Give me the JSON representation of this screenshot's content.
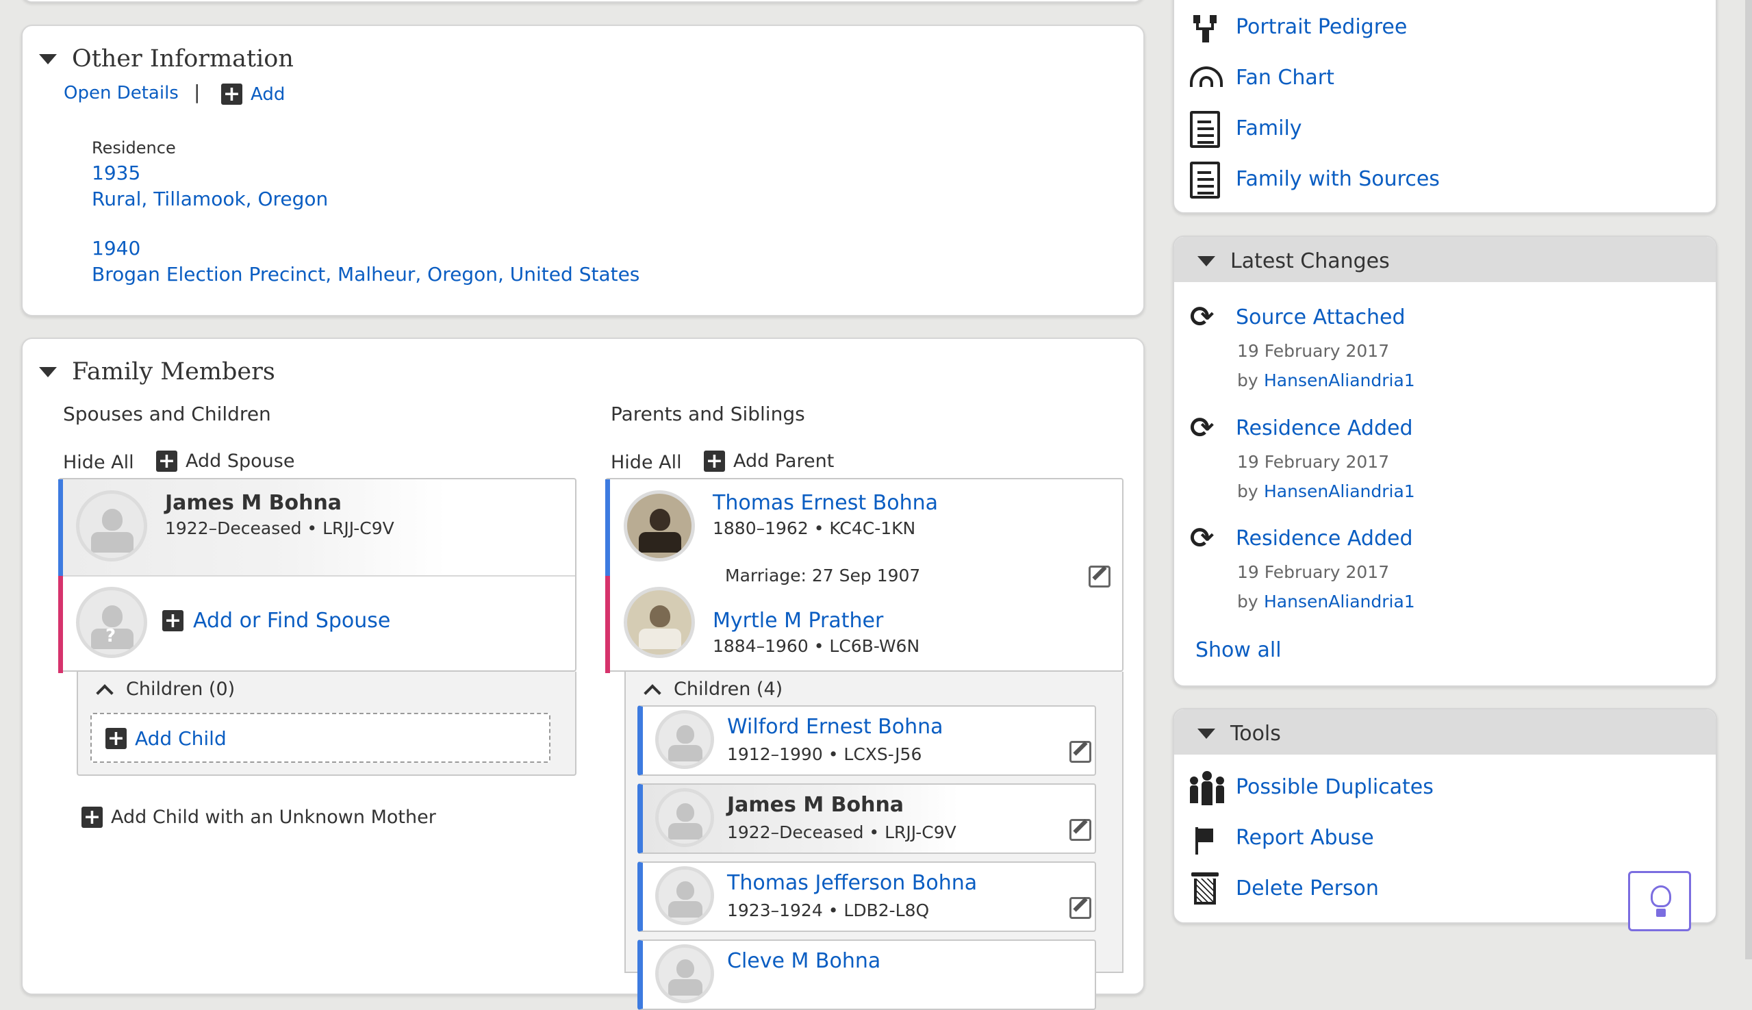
{
  "other_info": {
    "title": "Other Information",
    "open_details": "Open Details",
    "separator": "|",
    "add": "Add",
    "residence_label": "Residence",
    "residences": [
      {
        "year": "1935",
        "place": "Rural, Tillamook, Oregon"
      },
      {
        "year": "1940",
        "place": "Brogan Election Precinct, Malheur, Oregon, United States"
      }
    ]
  },
  "family": {
    "title": "Family Members",
    "spouses_heading": "Spouses and Children",
    "parents_heading": "Parents and Siblings",
    "hide_all": "Hide All",
    "add_spouse": "Add Spouse",
    "add_parent": "Add Parent",
    "self": {
      "name": "James M Bohna",
      "info": "1922–Deceased • LRJJ-C9V"
    },
    "add_or_find_spouse": "Add or Find Spouse",
    "children_none": "Children (0)",
    "add_child": "Add Child",
    "add_child_unknown": "Add Child with an Unknown Mother",
    "father": {
      "name": "Thomas Ernest Bohna",
      "info": "1880–1962 • KC4C-1KN"
    },
    "marriage": "Marriage: 27 Sep 1907",
    "mother": {
      "name": "Myrtle M Prather",
      "info": "1884–1960 • LC6B-W6N"
    },
    "children_count": "Children (4)",
    "children": [
      {
        "name": "Wilford Ernest Bohna",
        "info": "1912–1990 • LCXS-J56"
      },
      {
        "name": "James M Bohna",
        "info": "1922–Deceased • LRJJ-C9V"
      },
      {
        "name": "Thomas Jefferson Bohna",
        "info": "1923–1924 • LDB2-L8Q"
      },
      {
        "name": "Cleve M Bohna",
        "info": ""
      }
    ]
  },
  "sidebar": {
    "charts": [
      "Portrait Pedigree",
      "Fan Chart",
      "Family",
      "Family with Sources"
    ],
    "latest_changes": {
      "title": "Latest Changes",
      "items": [
        {
          "title": "Source Attached",
          "date": "19 February 2017",
          "by": "by",
          "user": "HansenAliandria1"
        },
        {
          "title": "Residence Added",
          "date": "19 February 2017",
          "by": "by",
          "user": "HansenAliandria1"
        },
        {
          "title": "Residence Added",
          "date": "19 February 2017",
          "by": "by",
          "user": "HansenAliandria1"
        }
      ],
      "show_all": "Show all"
    },
    "tools": {
      "title": "Tools",
      "items": [
        "Possible Duplicates",
        "Report Abuse",
        "Delete Person"
      ]
    }
  },
  "colors": {
    "link": "#0a5dc2",
    "male": "#3d7be0",
    "female": "#d6336c",
    "help_border": "#7b6de0"
  }
}
